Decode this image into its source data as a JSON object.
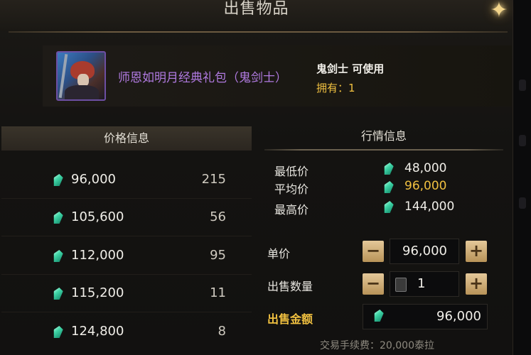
{
  "dialog": {
    "title": "出售物品",
    "close_icon": "close-star-icon"
  },
  "item": {
    "name": "师恩如明月经典礼包（鬼剑士）",
    "usable": "鬼剑士 可使用",
    "owned": "拥有：1",
    "icon": "character-portrait-icon",
    "name_color": "#b07ae0"
  },
  "price_info": {
    "header": "价格信息",
    "currency_icon": "gem-icon",
    "rows": [
      {
        "price": "96,000",
        "count": "215"
      },
      {
        "price": "105,600",
        "count": "56"
      },
      {
        "price": "112,000",
        "count": "95"
      },
      {
        "price": "115,200",
        "count": "11"
      },
      {
        "price": "124,800",
        "count": "8"
      }
    ]
  },
  "market_info": {
    "header": "行情信息",
    "lowest_label": "最低价",
    "lowest_value": "48,000",
    "average_label": "平均价",
    "average_value": "96,000",
    "highest_label": "最高价",
    "highest_value": "144,000",
    "highlight_color": "#f0c040"
  },
  "sell": {
    "unit_price_label": "单价",
    "unit_price_value": "96,000",
    "quantity_label": "出售数量",
    "quantity_value": "1",
    "total_label": "出售金额",
    "total_value": "96,000",
    "minus": "−",
    "plus": "+",
    "fee": "交易手续费：20,000泰拉"
  }
}
